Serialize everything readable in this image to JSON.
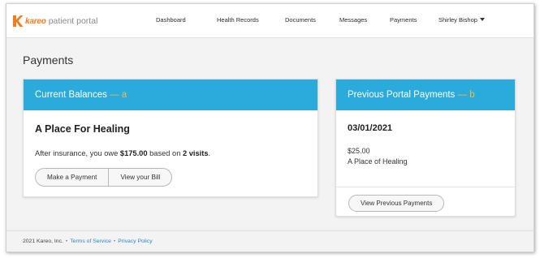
{
  "brand": {
    "name_brand": "kareo",
    "name_rest": "patient portal",
    "accent_color": "#f47d20",
    "icon": "kareo-k-logo-icon"
  },
  "nav": {
    "items": [
      "Dashboard",
      "Health Records",
      "Documents",
      "Messages",
      "Payments"
    ],
    "user": "Shirley Bishop",
    "user_icon": "caret-down-icon"
  },
  "page": {
    "title": "Payments"
  },
  "current_balances": {
    "header": "Current Balances",
    "annotation": "— a",
    "practice": "A Place For Healing",
    "owe_prefix": "After insurance, you owe",
    "owe_amount": "$175.00",
    "owe_middle": "based on",
    "owe_visits": "2 visits",
    "owe_suffix": ".",
    "buttons": [
      "Make a Payment",
      "View your Bill"
    ],
    "header_color": "#2baadc"
  },
  "previous_payments": {
    "header": "Previous Portal Payments",
    "annotation": "— b",
    "date": "03/01/2021",
    "amount": "$25.00",
    "practice": "A Place of Healing",
    "button": "View Previous Payments"
  },
  "footer": {
    "copyright": "2021 Kareo, Inc.",
    "separator": "•",
    "links": [
      "Terms of Service",
      "Privacy Policy"
    ]
  }
}
